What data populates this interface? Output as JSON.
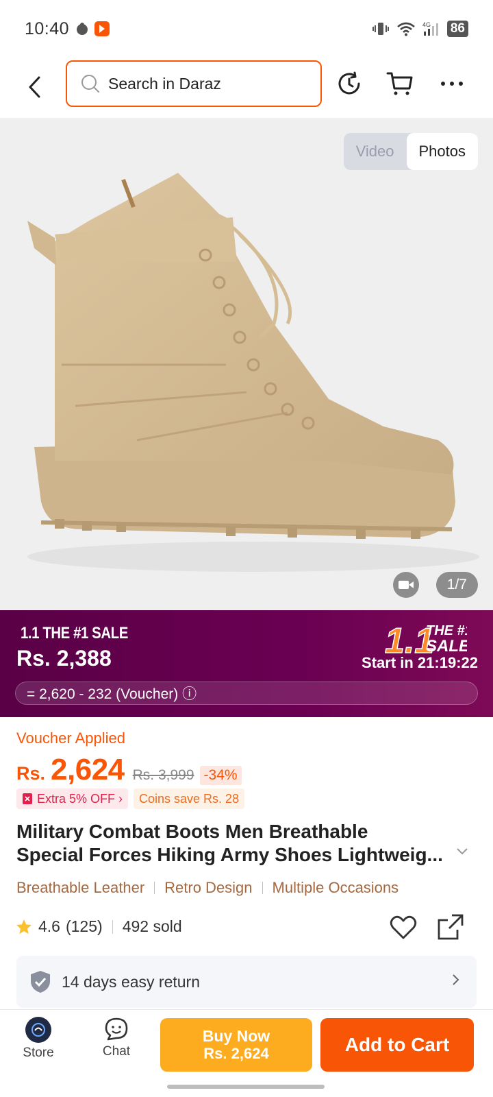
{
  "status_bar": {
    "time": "10:40",
    "battery": "86",
    "network": "4G"
  },
  "search": {
    "placeholder": "Search in Daraz"
  },
  "gallery": {
    "tabs": [
      {
        "label": "Video",
        "active": false
      },
      {
        "label": "Photos",
        "active": true
      }
    ],
    "counter": "1/7"
  },
  "sale": {
    "tag": "1.1 THE #1 SALE",
    "price": "Rs. 2,388",
    "logo_big": "1.1",
    "logo_small_1": "THE #1",
    "logo_small_2": "SALE",
    "start": "Start in 21:19:22",
    "voucher_breakdown": "= 2,620 - 232 (Voucher) ⓘ"
  },
  "price": {
    "voucher_applied": "Voucher Applied",
    "currency": "Rs.",
    "amount": "2,624",
    "original": "Rs. 3,999",
    "discount": "-34%",
    "promo_extra": "Extra 5% OFF ›",
    "promo_coins": "Coins save Rs. 28"
  },
  "product": {
    "title_line1": "Military Combat Boots Men Breathable",
    "title_line2": "Special Forces Hiking Army Shoes Lightweig...",
    "tags": [
      "Breathable Leather",
      "Retro Design",
      "Multiple Occasions"
    ],
    "rating": "4.6",
    "reviews": "(125)",
    "sold": "492 sold"
  },
  "return_policy": {
    "text": "14 days easy return"
  },
  "bottom_bar": {
    "store_label": "Store",
    "chat_label": "Chat",
    "buy_now_label": "Buy Now",
    "buy_now_price": "Rs. 2,624",
    "add_to_cart_label": "Add to Cart"
  },
  "colors": {
    "accent": "#f85606",
    "buy_now": "#fdab1f",
    "sale_banner": "#5a0046",
    "tag_text": "#a5683f"
  }
}
